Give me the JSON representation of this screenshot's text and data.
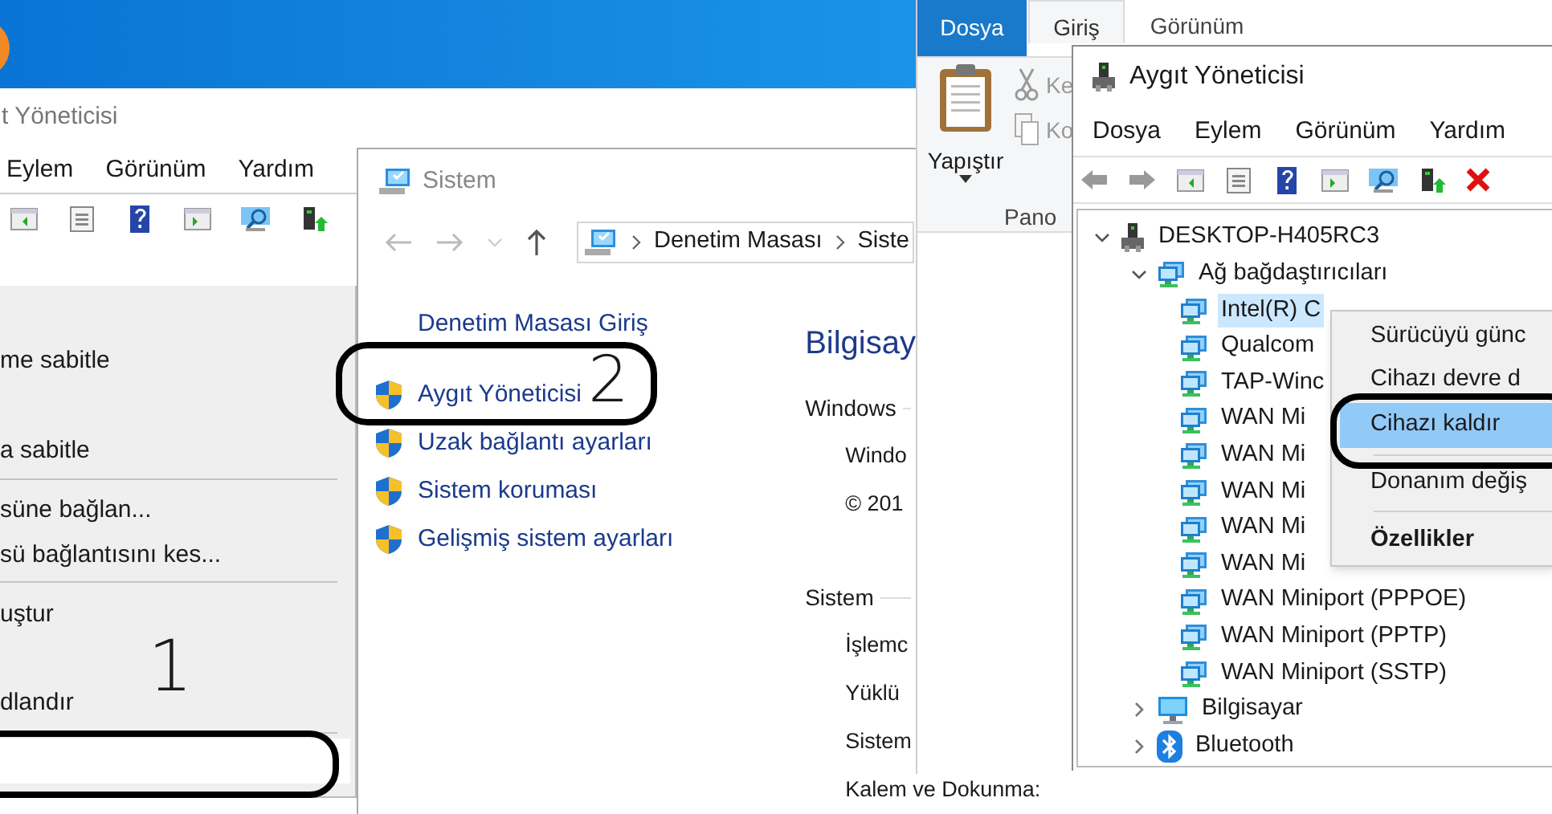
{
  "desktop_window": {
    "title": "t Yöneticisi",
    "menu": [
      "Eylem",
      "Görünüm",
      "Yardım"
    ]
  },
  "jump_list": {
    "items": [
      {
        "kind": "item",
        "label": "me sabitle",
        "selected": false
      },
      {
        "kind": "item",
        "label": "a sabitle",
        "selected": false
      },
      {
        "kind": "separator"
      },
      {
        "kind": "item",
        "label": "süne bağlan...",
        "selected": false
      },
      {
        "kind": "item",
        "label": "sü bağlantısını kes...",
        "selected": false
      },
      {
        "kind": "separator"
      },
      {
        "kind": "item",
        "label": "uştur",
        "selected": false
      },
      {
        "kind": "item",
        "label": "dlandır",
        "selected": false
      },
      {
        "kind": "separator"
      },
      {
        "kind": "item",
        "selected": true
      }
    ]
  },
  "system_window": {
    "title": "Sistem",
    "breadcrumb": [
      "Denetim Masası",
      "Siste"
    ],
    "links": [
      {
        "kind": "plain",
        "label": "Denetim Masası Giriş"
      },
      {
        "kind": "shield",
        "label": "Aygıt Yöneticisi"
      },
      {
        "kind": "shield",
        "label": "Uzak bağlantı ayarları"
      },
      {
        "kind": "shield",
        "label": "Sistem koruması"
      },
      {
        "kind": "shield",
        "label": "Gelişmiş sistem ayarları"
      }
    ],
    "heading": "Bilgisay",
    "info": [
      {
        "kind": "section",
        "text": "Windows"
      },
      {
        "kind": "value",
        "text": "Windo"
      },
      {
        "kind": "value",
        "text": "© 201"
      },
      {
        "kind": "section",
        "text": "Sistem"
      },
      {
        "kind": "value",
        "text": "İşlemc"
      },
      {
        "kind": "value",
        "text": "Yüklü"
      },
      {
        "kind": "value",
        "text": "Sistem"
      },
      {
        "kind": "value",
        "text": "Kalem ve Dokunma:"
      }
    ]
  },
  "explorer": {
    "tabs": [
      {
        "kind": "file",
        "label": "Dosya",
        "selected": false
      },
      {
        "kind": "tab",
        "label": "Giriş",
        "selected": true
      },
      {
        "kind": "tab",
        "label": "Görünüm",
        "selected": false
      }
    ],
    "paste": "Yapıştır",
    "commands": [
      "Ke",
      "Ko"
    ],
    "group": "Pano"
  },
  "device_manager": {
    "title": "Aygıt Yöneticisi",
    "menu": [
      "Dosya",
      "Eylem",
      "Görünüm",
      "Yardım"
    ],
    "tree": [
      {
        "kind": "host",
        "label": "DESKTOP-H405RC3",
        "expanded": true,
        "selected": false,
        "children": [
          {
            "kind": "network",
            "label": "Ağ bağdaştırıcıları",
            "expanded": true,
            "selected": false,
            "children": [
              {
                "kind": "network",
                "label": "Intel(R) C",
                "selected": true
              },
              {
                "kind": "network",
                "label": "Qualcom",
                "selected": false
              },
              {
                "kind": "network",
                "label": "TAP-Winc",
                "selected": false
              },
              {
                "kind": "network",
                "label": "WAN Mi",
                "selected": false
              },
              {
                "kind": "network",
                "label": "WAN Mi",
                "selected": false
              },
              {
                "kind": "network",
                "label": "WAN Mi",
                "selected": false
              },
              {
                "kind": "network",
                "label": "WAN Mi",
                "selected": false
              },
              {
                "kind": "network",
                "label": "WAN Mi",
                "selected": false
              },
              {
                "kind": "network",
                "label": "WAN Miniport (PPPOE)",
                "selected": false
              },
              {
                "kind": "network",
                "label": "WAN Miniport (PPTP)",
                "selected": false
              },
              {
                "kind": "network",
                "label": "WAN Miniport (SSTP)",
                "selected": false
              }
            ]
          },
          {
            "kind": "computer",
            "label": "Bilgisayar",
            "expanded": false,
            "selected": false
          },
          {
            "kind": "bluetooth",
            "label": "Bluetooth",
            "expanded": false,
            "selected": false
          }
        ]
      }
    ]
  },
  "context_menu": {
    "items": [
      {
        "kind": "item",
        "label": "Sürücüyü günc",
        "selected": false
      },
      {
        "kind": "item",
        "label": "Cihazı devre d",
        "selected": false
      },
      {
        "kind": "item",
        "label": "Cihazı kaldır",
        "selected": true
      },
      {
        "kind": "separator"
      },
      {
        "kind": "item",
        "label": "Donanım değiş",
        "selected": false
      },
      {
        "kind": "separator"
      },
      {
        "kind": "default",
        "label": "Özellikler",
        "selected": false
      }
    ]
  },
  "annotations": [
    {
      "text": "1"
    },
    {
      "text": "2"
    }
  ]
}
